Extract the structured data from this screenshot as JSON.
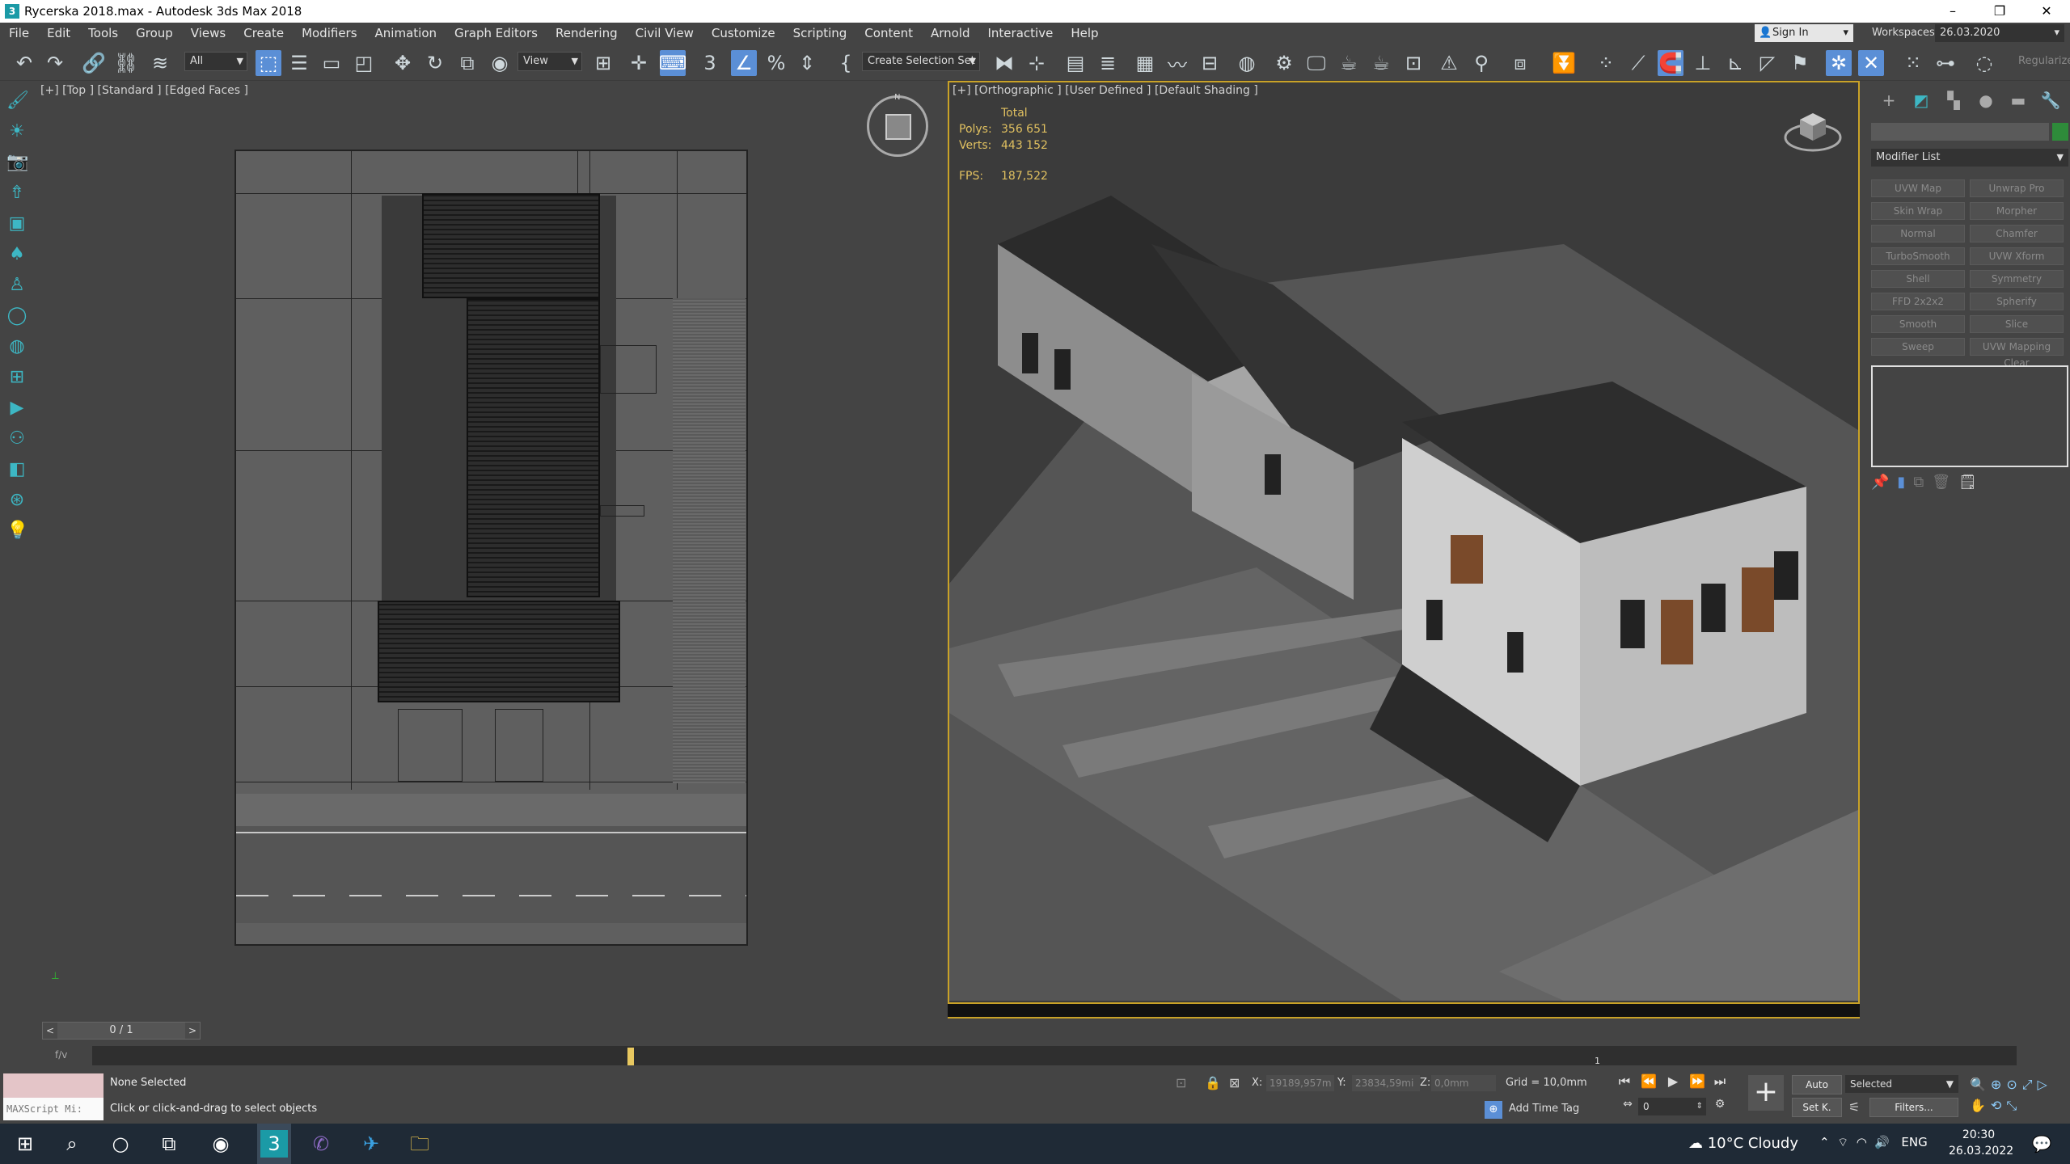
{
  "window": {
    "title": "Rycerska 2018.max - Autodesk 3ds Max 2018",
    "minimize": "–",
    "restore": "❐",
    "close": "✕"
  },
  "menu": {
    "items": [
      "File",
      "Edit",
      "Tools",
      "Group",
      "Views",
      "Create",
      "Modifiers",
      "Animation",
      "Graph Editors",
      "Rendering",
      "Civil View",
      "Customize",
      "Scripting",
      "Content",
      "Arnold",
      "Interactive",
      "Help"
    ],
    "sign_in": "Sign In",
    "workspaces_label": "Workspaces:",
    "workspaces_value": "26.03.2020"
  },
  "toolbar": {
    "selection_filter": "All",
    "reference_coord": "View",
    "selection_set": "Create Selection Set",
    "regularize": "Regularize"
  },
  "viewport_left": {
    "label": "[+] [Top ] [Standard ] [Edged Faces ]",
    "compass_n": "N"
  },
  "viewport_right": {
    "label": "[+] [Orthographic ] [User Defined ] [Default Shading ]",
    "stats_header": "Total",
    "polys_label": "Polys:",
    "polys_value": "356 651",
    "verts_label": "Verts:",
    "verts_value": "443 152",
    "fps_label": "FPS:",
    "fps_value": "187,522"
  },
  "command_panel": {
    "modifier_list": "Modifier List",
    "modifiers": [
      "UVW Map",
      "Unwrap Pro",
      "Skin Wrap",
      "Morpher",
      "Normal",
      "Chamfer",
      "TurboSmooth",
      "UVW Xform",
      "Shell",
      "Symmetry",
      "FFD 2x2x2",
      "Spherify",
      "Smooth",
      "Slice",
      "Sweep",
      "UVW Mapping Clear"
    ]
  },
  "timeline": {
    "frame": "0 / 1",
    "prev": "<",
    "next": ">",
    "track_label": "1",
    "curve_icon": "f/v"
  },
  "status": {
    "maxscript": "MAXScript Mi:",
    "selection": "None Selected",
    "prompt": "Click or click-and-drag to select objects",
    "x_label": "X:",
    "x_value": "19189,957m",
    "y_label": "Y:",
    "y_value": "23834,59mi",
    "z_label": "Z:",
    "z_value": "0,0mm",
    "grid": "Grid = 10,0mm",
    "add_time_tag": "Add Time Tag",
    "auto": "Auto",
    "set_key": "Set K.",
    "key_filter": "Selected",
    "filters": "Filters...",
    "frame_value": "0"
  },
  "taskbar": {
    "weather": "10°C  Cloudy",
    "lang": "ENG",
    "time": "20:30",
    "date": "26.03.2022"
  },
  "colors": {
    "viewport_active_border": "#c9a227",
    "stats_text": "#e0c060",
    "accent_blue": "#5b8fd6",
    "command_icon": "#3db7c4"
  }
}
